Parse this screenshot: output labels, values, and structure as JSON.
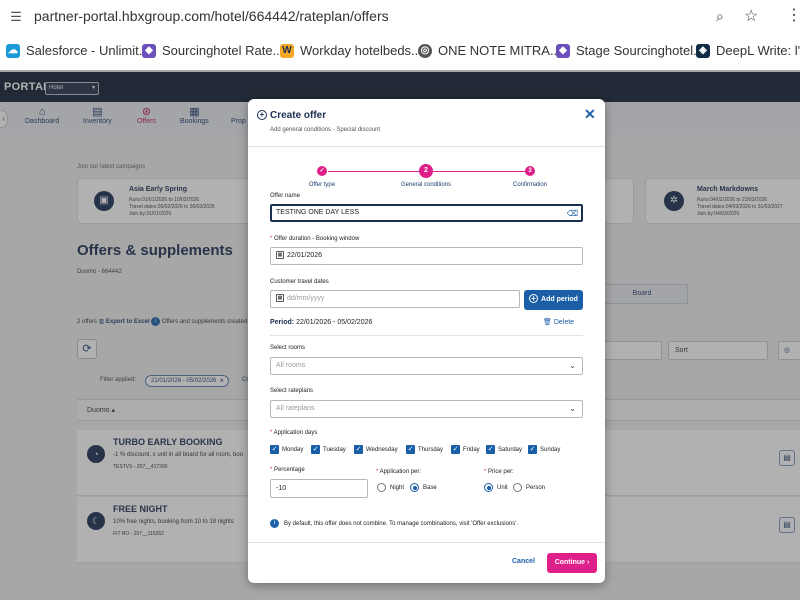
{
  "browser": {
    "url": "partner-portal.hbxgroup.com/hotel/664442/rateplan/offers",
    "bookmarks": [
      {
        "label": "Salesforce - Unlimit...",
        "icon": "salesforce-icon",
        "color": "#1a9bd7"
      },
      {
        "label": "Sourcinghotel Rate...",
        "icon": "sourcinghotel-icon",
        "color": "#6b4fbb"
      },
      {
        "label": "Workday hotelbeds...",
        "icon": "workday-icon",
        "color": "#f5a623"
      },
      {
        "label": "ONE NOTE MITRA...",
        "icon": "globe-icon",
        "color": "#555555"
      },
      {
        "label": "Stage Sourcinghotel...",
        "icon": "sourcinghotel-icon",
        "color": "#6b4fbb"
      },
      {
        "label": "DeepL Write: l'assi",
        "icon": "deepl-icon",
        "color": "#0f2b46"
      }
    ]
  },
  "app": {
    "portal_label": "PORTAL",
    "hotel_select": "Hotel",
    "nav": [
      {
        "label": "Dashboard",
        "icon": "home-icon"
      },
      {
        "label": "Inventory",
        "icon": "inventory-icon"
      },
      {
        "label": "Offers",
        "icon": "offers-icon",
        "active": true
      },
      {
        "label": "Bookings",
        "icon": "bookings-icon"
      },
      {
        "label": "Prop",
        "icon": "property-icon"
      }
    ],
    "campaigns_label": "Join our latest campaigns",
    "campaign_left": {
      "title": "Asia Early Spring",
      "runs": "Runs:01/01/2026 to 10/02/2026",
      "travel": "Travel dates:26/02/2026 to 30/03/2026",
      "join": "Join by:31/01/2026"
    },
    "campaign_right": {
      "title": "March Markdowns",
      "runs": "Runs:04/02/2026 to 23/03/2026",
      "travel": "Travel dates:04/03/2026 to 31/03/2027",
      "join": "Join by:04/03/2026"
    },
    "page_title": "Offers & supplements",
    "hotel_id": "Duomo - 664442",
    "offers_count": "2 offers",
    "export_label": "Export to Excel",
    "export_note": "Offers and supplements created t",
    "board_tab": "Board",
    "sort_label": "Sort",
    "filter_label": "Filter applied:",
    "filter_chip": "21/01/2026 - 05/02/2026",
    "filter_trailing": "Cl",
    "column_duomo": "Duomo",
    "rows": [
      {
        "title": "TURBO EARLY BOOKING",
        "desc": "-1 % discount, x unit in all board for all room, boo",
        "code": "TESTVS - 207__417396"
      },
      {
        "title": "FREE NIGHT",
        "desc": "10% free nights, booking from 10 to 18 nights",
        "code": "FIT RO - 207__116262"
      }
    ]
  },
  "modal": {
    "title": "Create offer",
    "subtitle": "Add general conditions - Special discount",
    "steps": [
      {
        "label": "Offer type",
        "marker": "✓"
      },
      {
        "label": "General conditions",
        "marker": "2"
      },
      {
        "label": "Confirmation",
        "marker": "3"
      }
    ],
    "offer_name_label": "Offer name",
    "offer_name_value": "TESTING ONE DAY LESS",
    "duration_label": "Offer duration - Booking window",
    "duration_value": "22/01/2026",
    "travel_dates_label": "Customer travel dates",
    "travel_dates_placeholder": "dd/mm/yyyy",
    "add_period": "Add period",
    "period_prefix": "Period:",
    "period_value": "22/01/2026 - 05/02/2026",
    "delete_label": "Delete",
    "select_rooms_label": "Select rooms",
    "select_rooms_value": "All rooms",
    "select_rateplans_label": "Select rateplans",
    "select_rateplans_value": "All rateplans",
    "app_days_label": "Application days",
    "days": [
      "Monday",
      "Tuesday",
      "Wednesday",
      "Thursday",
      "Friday",
      "Saturday",
      "Sunday"
    ],
    "percentage_label": "Percentage",
    "percentage_value": "-10",
    "application_per_label": "Application per:",
    "application_per_options": [
      "Night",
      "Base"
    ],
    "application_per_selected": "Base",
    "price_per_label": "Price per:",
    "price_per_options": [
      "Unit",
      "Person"
    ],
    "price_per_selected": "Unit",
    "note": "By default, this offer does not combine. To manage combinations, visit 'Offer exclusions'.",
    "cancel": "Cancel",
    "continue": "Continue"
  },
  "colors": {
    "accent_pink": "#e0208a",
    "primary_blue": "#1a5ea8",
    "navy": "#1a2e50"
  }
}
